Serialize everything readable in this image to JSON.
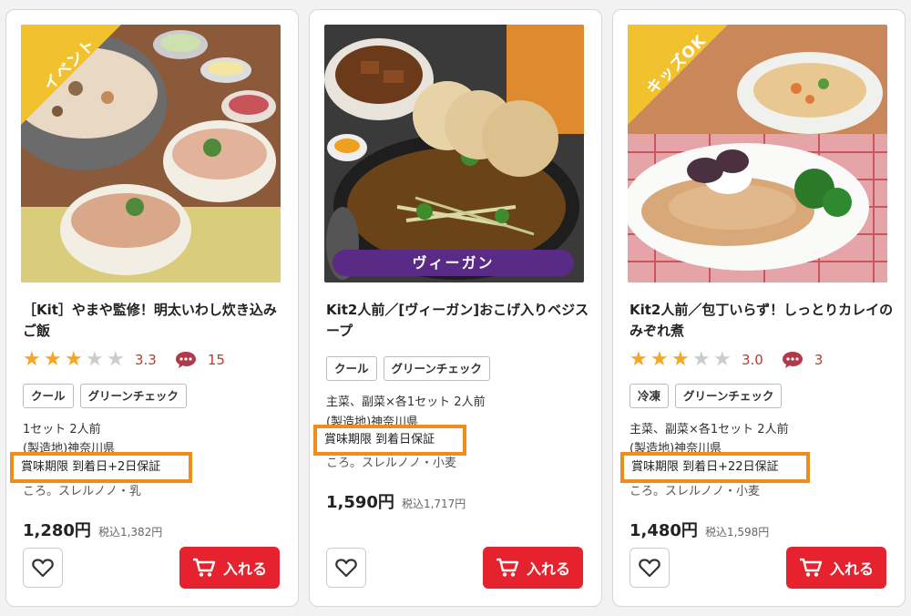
{
  "cards": [
    {
      "ribbon": "イベント",
      "title": "［Kit］やまや監修！明太いわし炊き込みご飯",
      "rating": {
        "value": "3.3",
        "stars": 3,
        "reviews": "15"
      },
      "tags": [
        "クール",
        "グリーンチェック"
      ],
      "spec_lines": [
        "1セット 2人前",
        "(製造地)神奈川県"
      ],
      "highlight": "賞味期限 到着日+2日保証",
      "obscured_line": "ころ。スレルノノ・乳",
      "price": "1,280円",
      "price_tax": "税込1,382円",
      "cart_label": "入れる"
    },
    {
      "banner": "ヴィーガン",
      "title": "Kit2人前／[ヴィーガン]おこげ入りベジスープ",
      "tags": [
        "クール",
        "グリーンチェック"
      ],
      "spec_lines": [
        "主菜、副菜×各1セット 2人前",
        "(製造地)神奈川県"
      ],
      "highlight": "賞味期限 到着日保証",
      "obscured_line": "ころ。スレルノノ・小麦",
      "price": "1,590円",
      "price_tax": "税込1,717円",
      "cart_label": "入れる"
    },
    {
      "ribbon": "キッズOK",
      "title": "Kit2人前／包丁いらず！しっとりカレイのみぞれ煮",
      "rating": {
        "value": "3.0",
        "stars": 3,
        "reviews": "3"
      },
      "tags": [
        "冷凍",
        "グリーンチェック"
      ],
      "spec_lines": [
        "主菜、副菜×各1セット 2人前",
        "(製造地)神奈川県"
      ],
      "highlight": "賞味期限 到着日+22日保証",
      "obscured_line": "ころ。スレルノノ・小麦",
      "price": "1,480円",
      "price_tax": "税込1,598円",
      "cart_label": "入れる"
    }
  ],
  "icons": {
    "star": "star-icon",
    "comment": "comment-bubble-icon",
    "heart": "heart-icon",
    "cart": "cart-icon"
  },
  "colors": {
    "accent_red": "#e6222e",
    "highlight_orange": "#f08c1c",
    "ribbon_yellow": "#f2c12e",
    "vegan_purple": "#5a2b86",
    "star_gold": "#f5a623",
    "rating_red": "#c0392b"
  }
}
